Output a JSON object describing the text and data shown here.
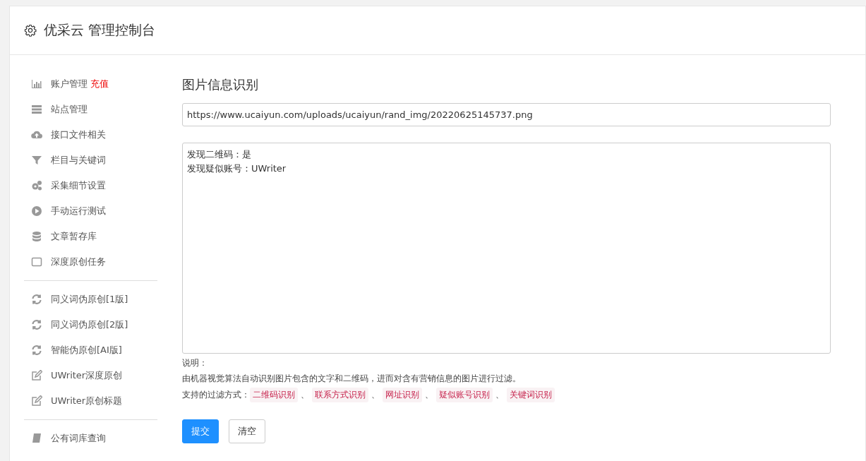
{
  "header": {
    "title": "优采云 管理控制台"
  },
  "sidebar": {
    "groups": [
      [
        {
          "label": "账户管理",
          "badge": "充值"
        },
        {
          "label": "站点管理"
        },
        {
          "label": "接口文件相关"
        },
        {
          "label": "栏目与关键词"
        },
        {
          "label": "采集细节设置"
        },
        {
          "label": "手动运行测试"
        },
        {
          "label": "文章暂存库"
        },
        {
          "label": "深度原创任务"
        }
      ],
      [
        {
          "label": "同义词伪原创[1版]"
        },
        {
          "label": "同义词伪原创[2版]"
        },
        {
          "label": "智能伪原创[AI版]"
        },
        {
          "label": "UWriter深度原创"
        },
        {
          "label": "UWriter原创标题"
        }
      ],
      [
        {
          "label": "公有词库查询"
        }
      ]
    ]
  },
  "main": {
    "title": "图片信息识别",
    "url_field": {
      "value": "https://www.ucaiyun.com/uploads/ucaiyun/rand_img/20220625145737.png"
    },
    "result_box": {
      "lines": [
        "发现二维码：是",
        "发现疑似账号：UWriter"
      ]
    },
    "notes_title": "说明：",
    "description": "由机器视觉算法自动识别图片包含的文字和二维码，进而对含有营销信息的图片进行过滤。",
    "methods_label": "支持的过滤方式：",
    "methods": [
      {
        "label": "二维码识别",
        "suffix": "、"
      },
      {
        "label": "联系方式识别",
        "suffix": "、"
      },
      {
        "label": "网址识别",
        "suffix": "、"
      },
      {
        "label": "疑似账号识别",
        "suffix": "、"
      },
      {
        "label": "关键词识别"
      }
    ],
    "buttons": [
      {
        "label": "提交",
        "kind": "primary"
      },
      {
        "label": "清空",
        "kind": "default"
      }
    ]
  }
}
